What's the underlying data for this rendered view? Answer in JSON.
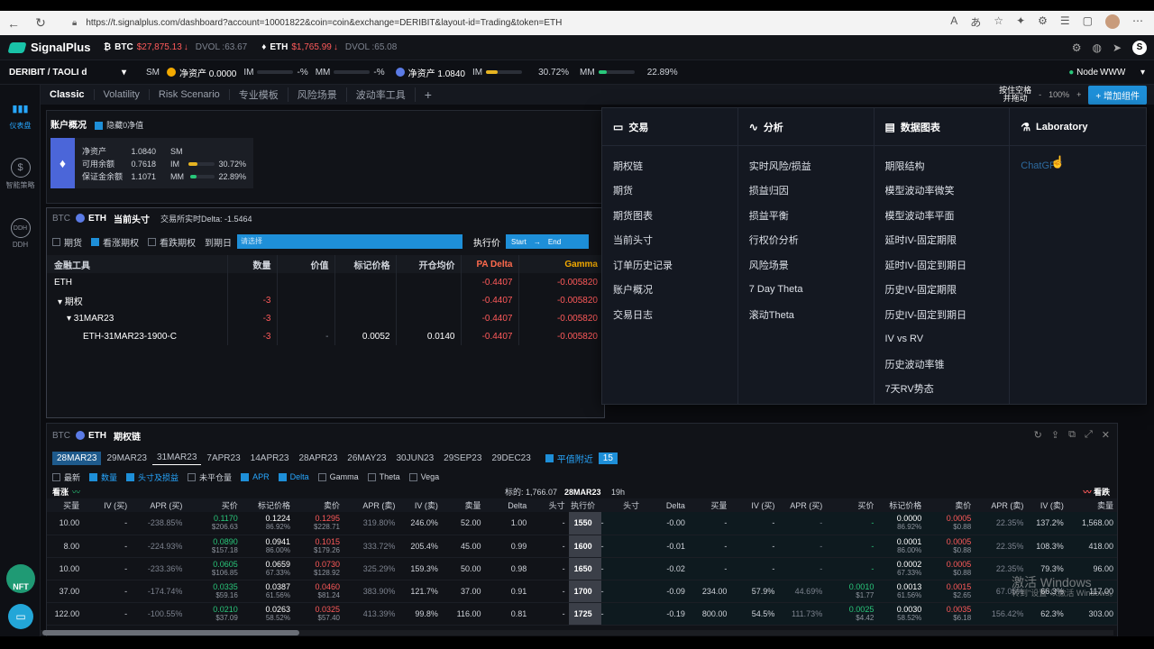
{
  "browser": {
    "url": "https://t.signalplus.com/dashboard?account=10001822&coin=coin&exchange=DERIBIT&layout-id=Trading&token=ETH"
  },
  "header": {
    "brand": "SignalPlus",
    "btc": {
      "sym": "BTC",
      "price": "$27,875.13",
      "dvol": "DVOL :63.67"
    },
    "eth": {
      "sym": "ETH",
      "price": "$1,765.99",
      "dvol": "DVOL :65.08"
    }
  },
  "account": {
    "selector": "DERIBIT / TAOLI d",
    "sm": "SM",
    "btc_net": "净资产 0.0000",
    "im1": "IM",
    "im1_val": "-%",
    "mm1": "MM",
    "mm1_val": "-%",
    "eth_net": "净资产 1.0840",
    "im2": "IM",
    "im2_val": "30.72%",
    "im2_fill": 0.31,
    "mm2": "MM",
    "mm2_val": "22.89%",
    "mm2_fill": 0.23,
    "node_label": "Node",
    "node_value": "WWW"
  },
  "sidebar": {
    "items": [
      "仪表盘",
      "智能策略",
      "DDH"
    ],
    "nft": "NFT"
  },
  "tabs": {
    "items": [
      "Classic",
      "Volatility",
      "Risk Scenario",
      "专业模板",
      "风险场景",
      "波动率工具"
    ],
    "add": "+",
    "lock_line1": "按住空格",
    "lock_line2": "并拖动",
    "zoom_minus": "-",
    "zoom": "100%",
    "zoom_plus": "+",
    "add_widget": "+ 增加组件"
  },
  "overview": {
    "title": "账户概况",
    "hide_zero": "隐藏0净值",
    "rows": [
      {
        "label": "净资产",
        "value": "1.0840"
      },
      {
        "label": "可用余额",
        "value": "0.7618"
      },
      {
        "label": "保证金余额",
        "value": "1.1071"
      }
    ],
    "sm": "SM",
    "im_label": "IM",
    "im_value": "30.72%",
    "mm_label": "MM",
    "mm_value": "22.89%"
  },
  "positions": {
    "btc": "BTC",
    "eth": "ETH",
    "title": "当前头寸",
    "delta_note": "交易所实时Delta: -1.5464",
    "filters": {
      "futures": "期货",
      "calls": "看涨期权",
      "puts": "看跌期权",
      "expiry": "到期日",
      "expiry_placeholder": "请选择",
      "strike": "执行价",
      "start": "Start",
      "end": "End"
    },
    "columns": [
      "金融工具",
      "数量",
      "价值",
      "标记价格",
      "开仓均价",
      "PA Delta",
      "Gamma"
    ],
    "rows": [
      {
        "name": "ETH",
        "qty": "",
        "val": "",
        "mark": "",
        "avg": "",
        "delta": "-0.4407",
        "gamma": "-0.005820"
      },
      {
        "name": "▾ 期权",
        "qty": "-3",
        "val": "",
        "mark": "",
        "avg": "",
        "delta": "-0.4407",
        "gamma": "-0.005820"
      },
      {
        "name": "▾ 31MAR23",
        "qty": "-3",
        "val": "",
        "mark": "",
        "avg": "",
        "delta": "-0.4407",
        "gamma": "-0.005820"
      },
      {
        "name": "ETH-31MAR23-1900-C",
        "qty": "-3",
        "val": "-",
        "mark": "0.0052",
        "avg": "0.0140",
        "delta": "-0.4407",
        "gamma": "-0.005820"
      }
    ]
  },
  "menu": {
    "columns": [
      {
        "title": "交易",
        "icon": "wallet-icon",
        "items": [
          "期权链",
          "期货",
          "期货图表",
          "当前头寸",
          "订单历史记录",
          "账户概况",
          "交易日志"
        ]
      },
      {
        "title": "分析",
        "icon": "analytics-icon",
        "items": [
          "实时风险/损益",
          "损益归因",
          "损益平衡",
          "行权价分析",
          "风险场景",
          "7 Day Theta",
          "滚动Theta"
        ]
      },
      {
        "title": "数据图表",
        "icon": "database-icon",
        "items": [
          "期限结构",
          "模型波动率微笑",
          "模型波动率平面",
          "延时IV-固定期限",
          "延时IV-固定到期日",
          "历史IV-固定期限",
          "历史IV-固定到期日",
          "IV vs RV",
          "历史波动率锥",
          "7天RV势态"
        ]
      },
      {
        "title": "Laboratory",
        "icon": "lab-icon",
        "items": [
          "ChatGPT"
        ]
      }
    ]
  },
  "chain": {
    "btc": "BTC",
    "eth": "ETH",
    "title": "期权链",
    "expiries": [
      "28MAR23",
      "29MAR23",
      "31MAR23",
      "7APR23",
      "14APR23",
      "28APR23",
      "26MAY23",
      "30JUN23",
      "29SEP23",
      "29DEC23"
    ],
    "near_money": "平值附近",
    "near_count": "15",
    "toggles": [
      "最新",
      "数量",
      "头寸及损益",
      "未平仓量",
      "APR",
      "Delta",
      "Gamma",
      "Theta",
      "Vega"
    ],
    "calls_label": "看涨",
    "puts_label": "看跌",
    "index_label": "标的: 1,766.07",
    "expiry_label": "28MAR23",
    "tte": "19h",
    "call_cols": [
      "买量",
      "IV (买)",
      "APR (买)",
      "买价",
      "标记价格",
      "卖价",
      "APR (卖)",
      "IV (卖)",
      "卖量",
      "Delta",
      "头寸"
    ],
    "strike_col": "执行价",
    "put_cols": [
      "头寸",
      "Delta",
      "买量",
      "IV (买)",
      "APR (买)",
      "买价",
      "标记价格",
      "卖价",
      "APR (卖)",
      "IV (卖)",
      "卖量"
    ],
    "rows": [
      {
        "strike": "1550",
        "c": [
          "10.00",
          "-",
          "-238.85%",
          "0.1170|$206.63",
          "0.1224|86.92%",
          "0.1295|$228.71",
          "319.80%",
          "246.0%",
          "52.00",
          "1.00",
          "-"
        ],
        "p": [
          "-",
          "-0.00",
          "-",
          "-",
          "-",
          "-",
          "0.0000|86.92%",
          "0.0005|$0.88",
          "22.35%",
          "137.2%",
          "1,568.00"
        ]
      },
      {
        "strike": "1600",
        "c": [
          "8.00",
          "-",
          "-224.93%",
          "0.0890|$157.18",
          "0.0941|86.00%",
          "0.1015|$179.26",
          "333.72%",
          "205.4%",
          "45.00",
          "0.99",
          "-"
        ],
        "p": [
          "-",
          "-0.01",
          "-",
          "-",
          "-",
          "-",
          "0.0001|86.00%",
          "0.0005|$0.88",
          "22.35%",
          "108.3%",
          "418.00"
        ]
      },
      {
        "strike": "1650",
        "c": [
          "10.00",
          "-",
          "-233.36%",
          "0.0605|$106.85",
          "0.0659|67.33%",
          "0.0730|$128.92",
          "325.29%",
          "159.3%",
          "50.00",
          "0.98",
          "-"
        ],
        "p": [
          "-",
          "-0.02",
          "-",
          "-",
          "-",
          "-",
          "0.0002|67.33%",
          "0.0005|$0.88",
          "22.35%",
          "79.3%",
          "96.00"
        ]
      },
      {
        "strike": "1700",
        "c": [
          "37.00",
          "-",
          "-174.74%",
          "0.0335|$59.16",
          "0.0387|61.56%",
          "0.0460|$81.24",
          "383.90%",
          "121.7%",
          "37.00",
          "0.91",
          "-"
        ],
        "p": [
          "-",
          "-0.09",
          "234.00",
          "57.9%",
          "44.69%",
          "0.0010|$1.77",
          "0.0013|61.56%",
          "0.0015|$2.65",
          "67.05%",
          "66.3%",
          "117.00"
        ]
      },
      {
        "strike": "1725",
        "c": [
          "122.00",
          "-",
          "-100.55%",
          "0.0210|$37.09",
          "0.0263|58.52%",
          "0.0325|$57.40",
          "413.39%",
          "99.8%",
          "116.00",
          "0.81",
          "-"
        ],
        "p": [
          "-",
          "-0.19",
          "800.00",
          "54.5%",
          "111.73%",
          "0.0025|$4.42",
          "0.0030|58.52%",
          "0.0035|$6.18",
          "156.42%",
          "62.3%",
          "303.00"
        ]
      }
    ]
  },
  "watermark": {
    "line1": "激活 Windows",
    "line2": "转到\"设置\"以激活 Windows。"
  }
}
